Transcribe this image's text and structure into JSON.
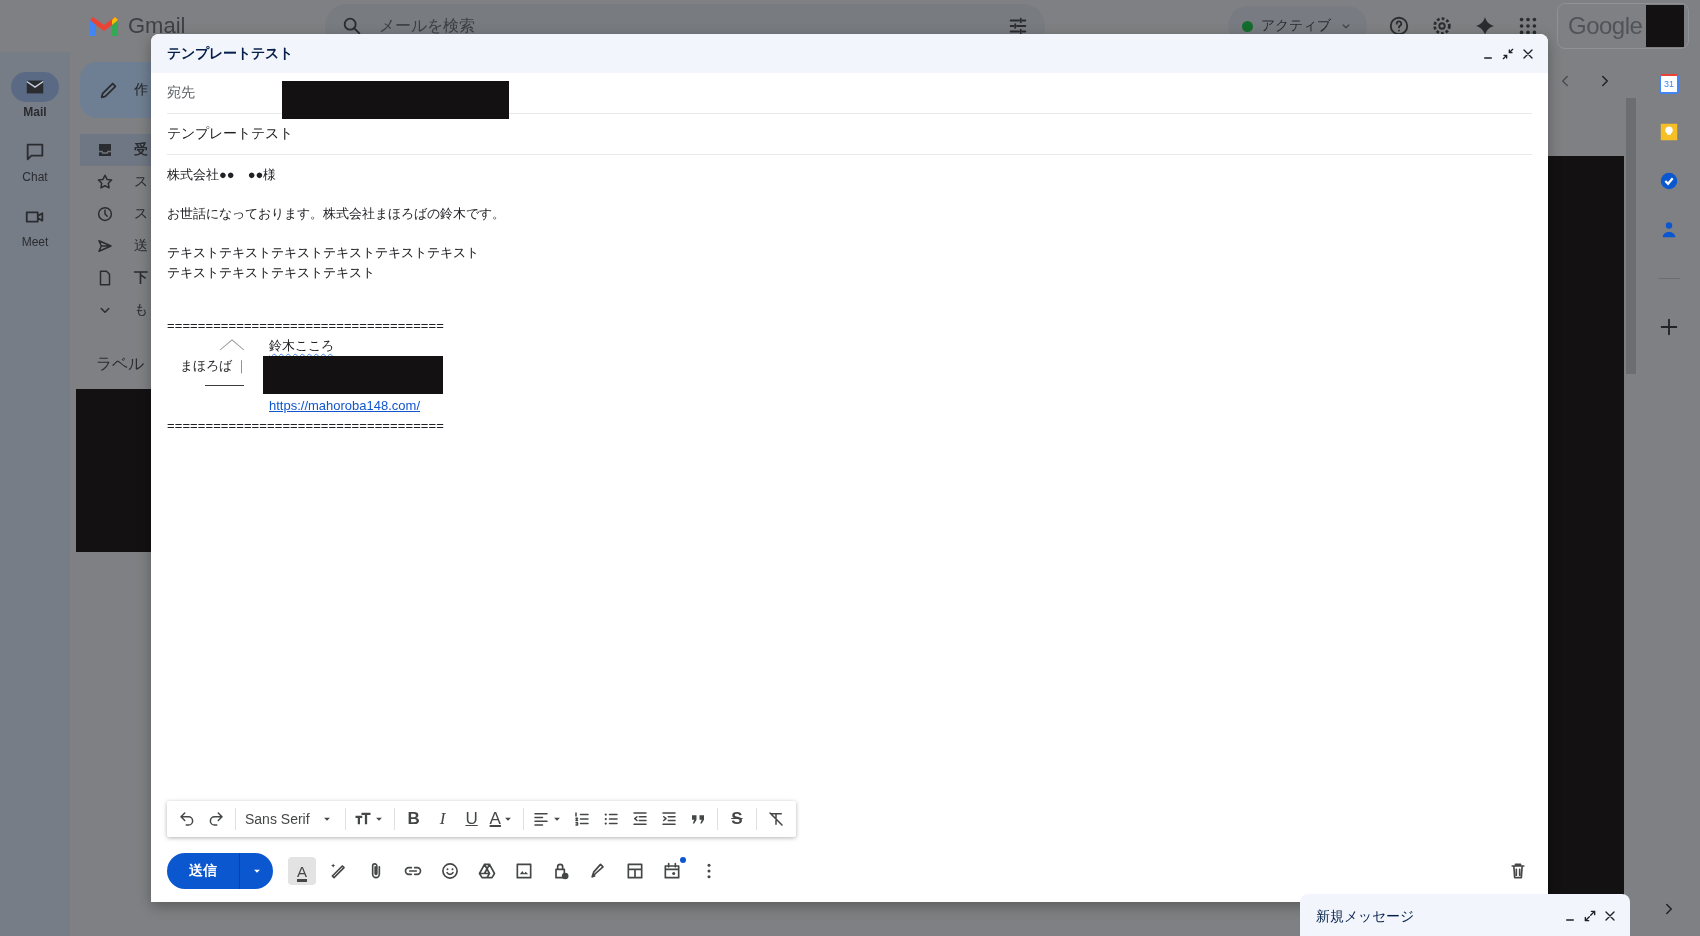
{
  "header": {
    "logo": "Gmail",
    "search": {
      "placeholder": "メールを検索"
    },
    "status": {
      "label": "アクティブ"
    },
    "brand": "Google",
    "account_redacted": true
  },
  "rail": [
    {
      "label": "Mail",
      "selected": true
    },
    {
      "label": "Chat",
      "selected": false
    },
    {
      "label": "Meet",
      "selected": false
    }
  ],
  "nav": {
    "compose": "作",
    "items": [
      {
        "label": "受",
        "selected": true,
        "bold": true
      },
      {
        "label": "ス",
        "selected": false,
        "bold": false
      },
      {
        "label": "ス",
        "selected": false,
        "bold": false
      },
      {
        "label": "送",
        "selected": false,
        "bold": false
      },
      {
        "label": "下",
        "selected": false,
        "bold": true
      },
      {
        "label": "も",
        "selected": false,
        "bold": false
      }
    ],
    "labels_heading": "ラベル",
    "labels_redacted": true
  },
  "list": {
    "redacted": true
  },
  "side_panel": {
    "calendar_day": "31"
  },
  "compose": {
    "title": "テンプレートテスト",
    "to": {
      "label": "宛先",
      "redacted": true
    },
    "subject": "テンプレートテスト",
    "body": [
      [
        "株式会社●●　●●様"
      ],
      [
        "お世話になっております。株式会社まほろばの鈴木です。"
      ],
      [
        "テキストテキストテキストテキストテキストテキスト",
        "テキストテキストテキストテキスト"
      ]
    ],
    "signature": {
      "rule_top": "====================================",
      "name": "鈴木こころ",
      "name_misspelled": true,
      "company": "まほろば",
      "divider": "｜",
      "underline": "———",
      "contact_redacted": true,
      "link": "https://mahoroba148.com/",
      "rule_bottom": "===================================="
    },
    "format_bar": [
      {
        "kind": "undo"
      },
      {
        "kind": "redo"
      },
      {
        "kind": "font",
        "label": "Sans Serif"
      },
      {
        "kind": "size"
      },
      {
        "kind": "bold",
        "glyph": "B"
      },
      {
        "kind": "italic",
        "glyph": "I"
      },
      {
        "kind": "underline",
        "glyph": "U"
      },
      {
        "kind": "color",
        "glyph": "A"
      },
      {
        "kind": "align"
      },
      {
        "kind": "numbered"
      },
      {
        "kind": "bullets"
      },
      {
        "kind": "outdent"
      },
      {
        "kind": "indent"
      },
      {
        "kind": "quote"
      },
      {
        "kind": "strike",
        "glyph": "S"
      },
      {
        "kind": "clear"
      }
    ],
    "send": "送信",
    "formatting": {
      "glyph": "A",
      "selected": true
    },
    "schedule_dot": true
  },
  "minimized": {
    "title": "新規メッセージ"
  }
}
